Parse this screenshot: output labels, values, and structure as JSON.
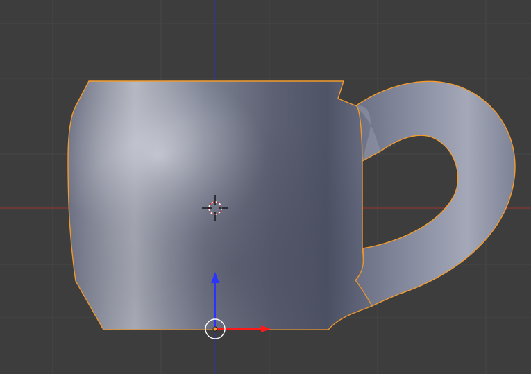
{
  "viewport": {
    "view": "front-orthographic",
    "background_color": "#3d3d3d",
    "grid_color": "#474747",
    "x_axis_color": "#9b3232",
    "z_axis_color": "#2c35a0"
  },
  "object": {
    "type": "mesh",
    "shape": "mug",
    "selected": true,
    "outline_color": "#f39b2b",
    "surface_colors": [
      "#c9ccd6",
      "#9a9fb1",
      "#5c6072"
    ]
  },
  "cursor_3d": {
    "icon": "crosshair-icon",
    "ring_colors": [
      "#ffffff",
      "#d12b2b"
    ]
  },
  "transform_gizmo": {
    "z_arrow_color": "#2a33ff",
    "x_arrow_color": "#ff1a1a",
    "pivot_color": "#ff9a3a",
    "ring_color": "#ffffff"
  }
}
